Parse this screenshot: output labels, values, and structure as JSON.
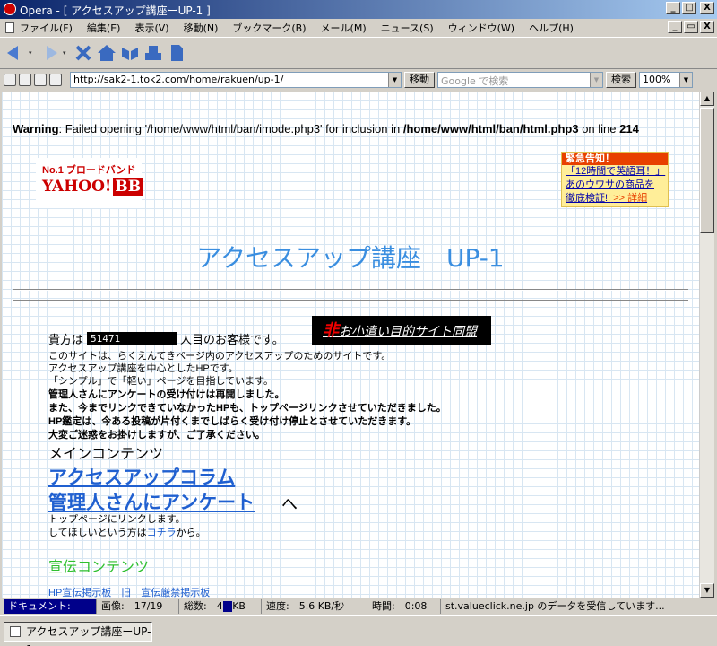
{
  "window": {
    "title": "Opera - [ アクセスアップ講座ーUP-1 ]",
    "min_glyph": "_",
    "max_glyph": "□",
    "close_glyph": "X",
    "restore_glyph": "▭"
  },
  "menu": [
    "ファイル(F)",
    "編集(E)",
    "表示(V)",
    "移動(N)",
    "ブックマーク(B)",
    "メール(M)",
    "ニュース(S)",
    "ウィンドウ(W)",
    "ヘルプ(H)"
  ],
  "toolbar": {
    "icons": [
      "back-icon",
      "forward-icon",
      "stop-icon",
      "home-icon",
      "hotlist-icon",
      "print-icon",
      "document-icon"
    ]
  },
  "address": {
    "url": "http://sak2-1.tok2.com/home/rakuen/up-1/",
    "go_label": "移動",
    "search_placeholder": "Google で検索",
    "search_label": "検索",
    "zoom": "100%"
  },
  "page": {
    "warning_prefix": "Warning",
    "warning_text": ": Failed opening '/home/www/html/ban/imode.php3' for inclusion in ",
    "warning_path": "/home/www/html/ban/html.php3",
    "warning_online": " on line ",
    "warning_line": "214",
    "ad_left_top": "No.1 ブロードバンド",
    "ad_left_logo": "YAHOO!",
    "ad_left_bb": "BB",
    "ad_right_header": "緊急告知！",
    "ad_right_l1": "「12時間で英語耳！」",
    "ad_right_l2": "あのウワサの商品を",
    "ad_right_l3": "徹底検証!!",
    "ad_right_detail": ">> 詳細",
    "site_title": "アクセスアップ講座　UP-1",
    "visitor_prefix": "貴方は",
    "visitor_count": "51471",
    "visitor_suffix": "人目のお客様です。",
    "banner_red": "非",
    "banner_text": "お小遣い目的サイト同盟",
    "desc1": "このサイトは、らくえんてきページ内のアクセスアップのためのサイトです。",
    "desc2": "アクセスアップ講座を中心としたHPです。",
    "desc3": "「シンプル」で「軽い」ページを目指しています。",
    "desc4": "管理人さんにアンケートの受け付けは再開しました。",
    "desc5": "また、今までリンクできていなかったHPも、トップページリンクさせていただきました。",
    "desc6": "HP鑑定は、今ある投稿が片付くまでしばらく受け付け停止とさせていただきます。",
    "desc7": "大変ご迷惑をお掛けしますが、ご了承ください。",
    "main_contents": "メインコンテンツ",
    "link1": "アクセスアップコラム",
    "link2": "管理人さんにアンケート",
    "arrow": "へ",
    "note1": "トップページにリンクします。",
    "note2_prefix": "してほしいという方は",
    "note2_link": "コチラ",
    "note2_suffix": "から。",
    "promo_header": "宣伝コンテンツ",
    "bottom_links": "HP宣伝掲示板　旧　宣伝厳禁掲示板"
  },
  "status": {
    "document": "ドキュメント:　100%",
    "images": "画像:　17/19",
    "total": "総数:　45 KB",
    "speed": "速度:　5.6 KB/秒",
    "time": "時間:　0:08",
    "message": "st.valueclick.ne.jp のデータを受信しています..."
  },
  "taskbar": {
    "task": "アクセスアップ講座ーUP-1"
  }
}
